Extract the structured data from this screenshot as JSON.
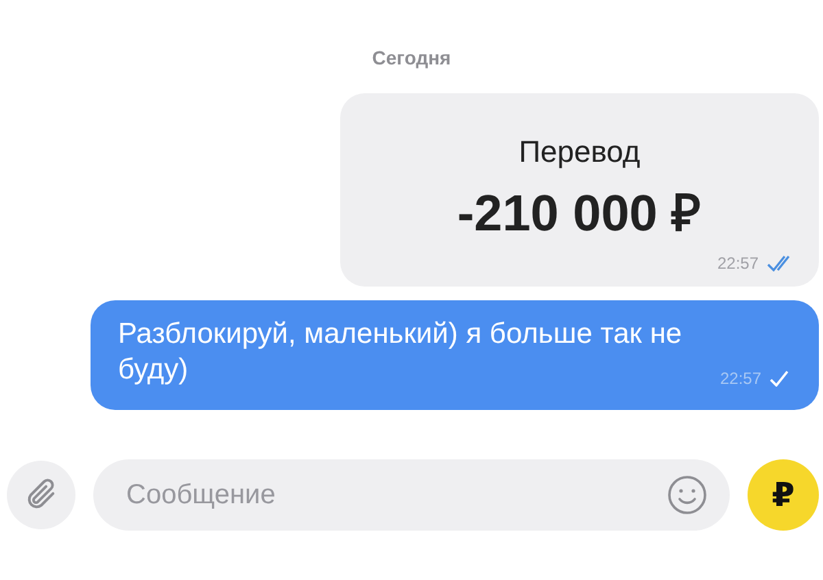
{
  "date_separator": "Сегодня",
  "messages": [
    {
      "kind": "transfer",
      "title": "Перевод",
      "amount": "-210 000 ₽",
      "time": "22:57",
      "read": true
    },
    {
      "kind": "text",
      "text": "Разблокируй, маленький) я больше так не буду)",
      "time": "22:57",
      "read": false
    }
  ],
  "composer": {
    "placeholder": "Сообщение",
    "money_button": "₽"
  }
}
